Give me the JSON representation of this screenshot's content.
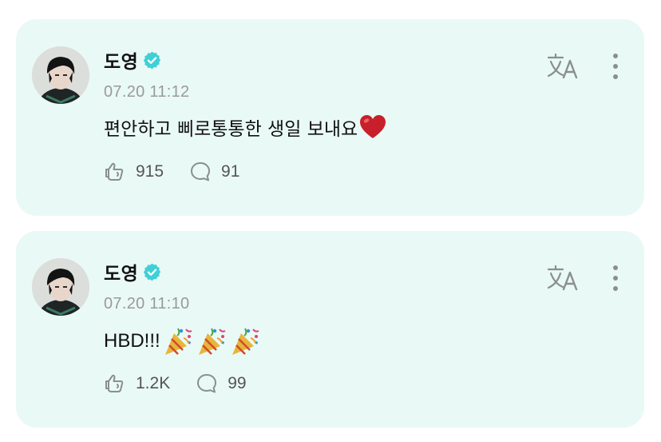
{
  "colors": {
    "card_bg": "#e9f9f6",
    "verified": "#3fd0d6",
    "muted_text": "#9a9a9a",
    "icon": "#8a8f8e"
  },
  "posts": [
    {
      "author": "도영",
      "verified_icon": "verified-badge-icon",
      "timestamp": "07.20 11:12",
      "text": "편안하고 삐로통통한 생일 보내요",
      "emoji": "red-heart",
      "stats": {
        "reposts": "915",
        "comments": "91"
      },
      "actions": [
        "translate-icon",
        "more-vertical-icon"
      ]
    },
    {
      "author": "도영",
      "verified_icon": "verified-badge-icon",
      "timestamp": "07.20 11:10",
      "text": "HBD!!!",
      "emoji": "party-popper x3",
      "stats": {
        "reposts": "1.2K",
        "comments": "99"
      },
      "actions": [
        "translate-icon",
        "more-vertical-icon"
      ]
    }
  ]
}
